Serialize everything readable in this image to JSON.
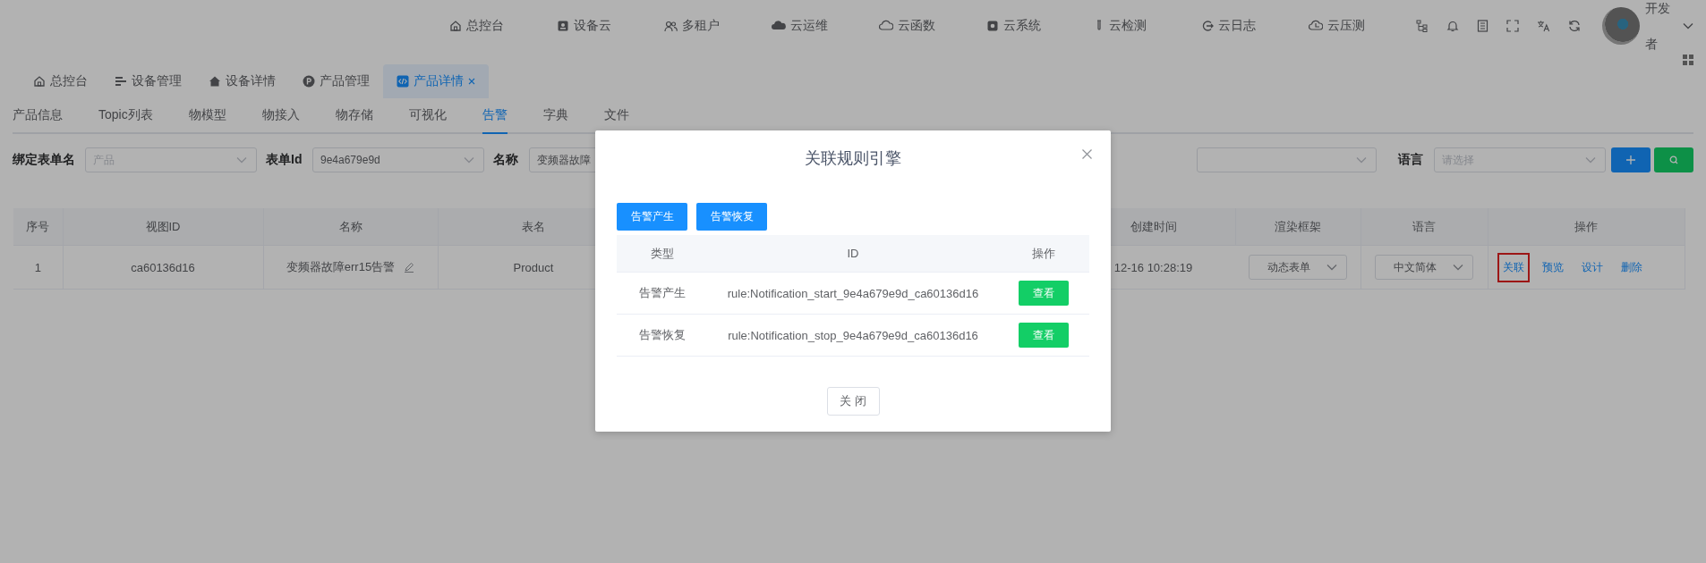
{
  "header": {
    "nav": [
      {
        "label": "总控台"
      },
      {
        "label": "设备云"
      },
      {
        "label": "多租户"
      },
      {
        "label": "云运维"
      },
      {
        "label": "云函数"
      },
      {
        "label": "云系统"
      },
      {
        "label": "云检测"
      },
      {
        "label": "云日志"
      },
      {
        "label": "云压测"
      }
    ],
    "user": "开发者"
  },
  "tabs": [
    {
      "label": "总控台",
      "selected": false,
      "closable": false
    },
    {
      "label": "设备管理",
      "selected": false,
      "closable": false
    },
    {
      "label": "设备详情",
      "selected": false,
      "closable": false
    },
    {
      "label": "产品管理",
      "selected": false,
      "closable": false
    },
    {
      "label": "产品详情",
      "selected": true,
      "closable": true
    }
  ],
  "sub_tabs": [
    {
      "label": "产品信息",
      "selected": false
    },
    {
      "label": "Topic列表",
      "selected": false
    },
    {
      "label": "物模型",
      "selected": false
    },
    {
      "label": "物接入",
      "selected": false
    },
    {
      "label": "物存储",
      "selected": false
    },
    {
      "label": "可视化",
      "selected": false
    },
    {
      "label": "告警",
      "selected": true
    },
    {
      "label": "字典",
      "selected": false
    },
    {
      "label": "文件",
      "selected": false
    }
  ],
  "filters": [
    {
      "kind": "select",
      "label": "绑定表单名",
      "placeholder": "产品"
    },
    {
      "kind": "select",
      "label": "表单Id",
      "value": "9e4a679e9d"
    },
    {
      "kind": "text",
      "label": "名称",
      "value": "变频器故障"
    },
    {
      "kind": "hidden-select"
    },
    {
      "kind": "select",
      "label": "语言",
      "placeholder": "请选择"
    }
  ],
  "table": {
    "columns": [
      "序号",
      "视图ID",
      "名称",
      "表名",
      "创建时间",
      "渲染框架",
      "语言",
      "操作"
    ],
    "rows": [
      {
        "index": "1",
        "view_id": "ca60136d16",
        "name": "变频器故障err15告警",
        "table_name": "Product",
        "created": "12-16 10:28:19",
        "framework": "动态表单",
        "language": "中文简体",
        "actions": [
          {
            "label": "关联",
            "highlighted": true
          },
          {
            "label": "预览",
            "highlighted": false
          },
          {
            "label": "设计",
            "highlighted": false
          },
          {
            "label": "删除",
            "highlighted": false
          }
        ]
      }
    ]
  },
  "dialog": {
    "title": "关联规则引擎",
    "buttons": [
      "告警产生",
      "告警恢复"
    ],
    "columns": [
      "类型",
      "ID",
      "操作"
    ],
    "rows": [
      {
        "type": "告警产生",
        "id": "rule:Notification_start_9e4a679e9d_ca60136d16",
        "action": "查看"
      },
      {
        "type": "告警恢复",
        "id": "rule:Notification_stop_9e4a679e9d_ca60136d16",
        "action": "查看"
      }
    ],
    "close": "关 闭"
  }
}
